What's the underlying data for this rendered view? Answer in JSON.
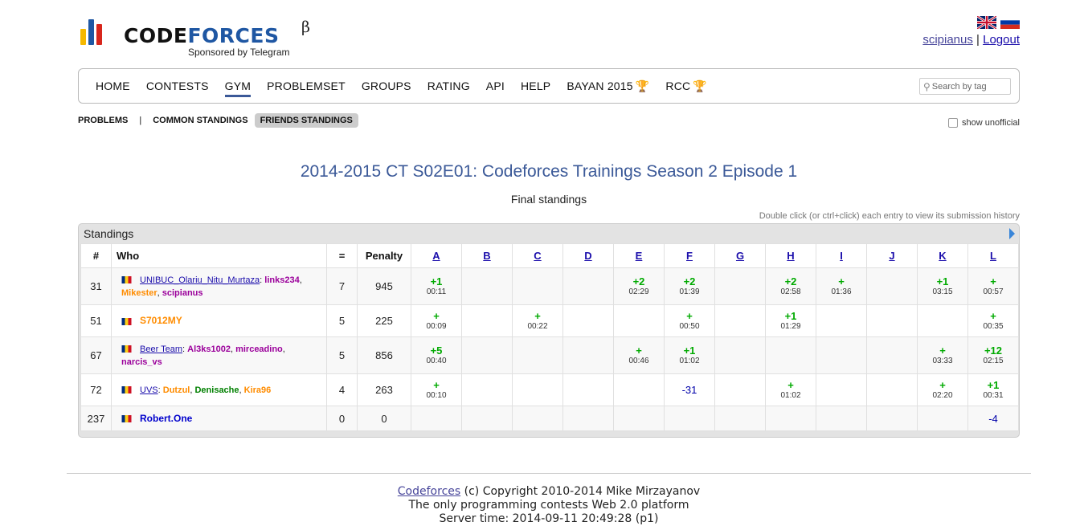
{
  "header": {
    "brand_part1": "CODE",
    "brand_part2": "FORCES",
    "beta": "β",
    "sponsor": "Sponsored by Telegram",
    "user": "scipianus",
    "separator": "|",
    "logout": "Logout",
    "logo_colors": [
      "#f5b800",
      "#1f57a3",
      "#d8261c"
    ]
  },
  "nav": {
    "items": [
      "HOME",
      "CONTESTS",
      "GYM",
      "PROBLEMSET",
      "GROUPS",
      "RATING",
      "API",
      "HELP",
      "BAYAN 2015",
      "RCC"
    ],
    "active": "GYM",
    "trophy_icon": "🏆",
    "search_placeholder": "Search by tag"
  },
  "submenu": {
    "problems": "PROBLEMS",
    "sep": "|",
    "common": "COMMON STANDINGS",
    "friends": "FRIENDS STANDINGS",
    "show_unofficial": "show unofficial"
  },
  "contest": {
    "title": "2014-2015 CT S02E01: Codeforces Trainings Season 2 Episode 1",
    "subtitle": "Final standings",
    "hint": "Double click (or ctrl+click) each entry to view its submission history"
  },
  "standings": {
    "heading": "Standings",
    "columns": {
      "rank": "#",
      "who": "Who",
      "solved": "=",
      "penalty": "Penalty"
    },
    "problems": [
      "A",
      "B",
      "C",
      "D",
      "E",
      "F",
      "G",
      "H",
      "I",
      "J",
      "K",
      "L"
    ],
    "rows": [
      {
        "rank": "31",
        "team": "UNIBUC_Olariu_Nitu_Murtaza",
        "members": [
          {
            "name": "links234",
            "color": "purple"
          },
          {
            "name": "Mikester",
            "color": "orange"
          },
          {
            "name": "scipianus",
            "color": "purple"
          }
        ],
        "solved": "7",
        "penalty": "945",
        "cells": [
          {
            "v": "+1",
            "t": "00:11"
          },
          {},
          {},
          {},
          {
            "v": "+2",
            "t": "02:29"
          },
          {
            "v": "+2",
            "t": "01:39"
          },
          {},
          {
            "v": "+2",
            "t": "02:58"
          },
          {
            "v": "+",
            "t": "01:36"
          },
          {},
          {
            "v": "+1",
            "t": "03:15"
          },
          {
            "v": "+",
            "t": "00:57"
          }
        ]
      },
      {
        "rank": "51",
        "single": "S7012MY",
        "single_color": "orange",
        "solved": "5",
        "penalty": "225",
        "cells": [
          {
            "v": "+",
            "t": "00:09"
          },
          {},
          {
            "v": "+",
            "t": "00:22"
          },
          {},
          {},
          {
            "v": "+",
            "t": "00:50"
          },
          {},
          {
            "v": "+1",
            "t": "01:29"
          },
          {},
          {},
          {},
          {
            "v": "+",
            "t": "00:35"
          }
        ]
      },
      {
        "rank": "67",
        "team": "Beer Team",
        "members": [
          {
            "name": "Al3ks1002",
            "color": "purple"
          },
          {
            "name": "mirceadino",
            "color": "purple"
          },
          {
            "name": "narcis_vs",
            "color": "purple"
          }
        ],
        "solved": "5",
        "penalty": "856",
        "cells": [
          {
            "v": "+5",
            "t": "00:40"
          },
          {},
          {},
          {},
          {
            "v": "+",
            "t": "00:46"
          },
          {
            "v": "+1",
            "t": "01:02"
          },
          {},
          {},
          {},
          {},
          {
            "v": "+",
            "t": "03:33"
          },
          {
            "v": "+12",
            "t": "02:15"
          }
        ]
      },
      {
        "rank": "72",
        "team": "UVS",
        "members": [
          {
            "name": "Dutzul",
            "color": "orange"
          },
          {
            "name": "Denisache",
            "color": "green"
          },
          {
            "name": "Kira96",
            "color": "orange"
          }
        ],
        "solved": "4",
        "penalty": "263",
        "cells": [
          {
            "v": "+",
            "t": "00:10"
          },
          {},
          {},
          {},
          {},
          {
            "neg": "-31"
          },
          {},
          {
            "v": "+",
            "t": "01:02"
          },
          {},
          {},
          {
            "v": "+",
            "t": "02:20"
          },
          {
            "v": "+1",
            "t": "00:31"
          }
        ]
      },
      {
        "rank": "237",
        "single": "Robert.One",
        "single_color": "blue",
        "solved": "0",
        "penalty": "0",
        "cells": [
          {},
          {},
          {},
          {},
          {},
          {},
          {},
          {},
          {},
          {},
          {},
          {
            "neg": "-4"
          }
        ]
      }
    ]
  },
  "footer": {
    "link": "Codeforces",
    "copyright": " (c) Copyright 2010-2014 Mike Mirzayanov",
    "line2": "The only programming contests Web 2.0 platform",
    "line3": "Server time: 2014-09-11 20:49:28 (p1)"
  }
}
